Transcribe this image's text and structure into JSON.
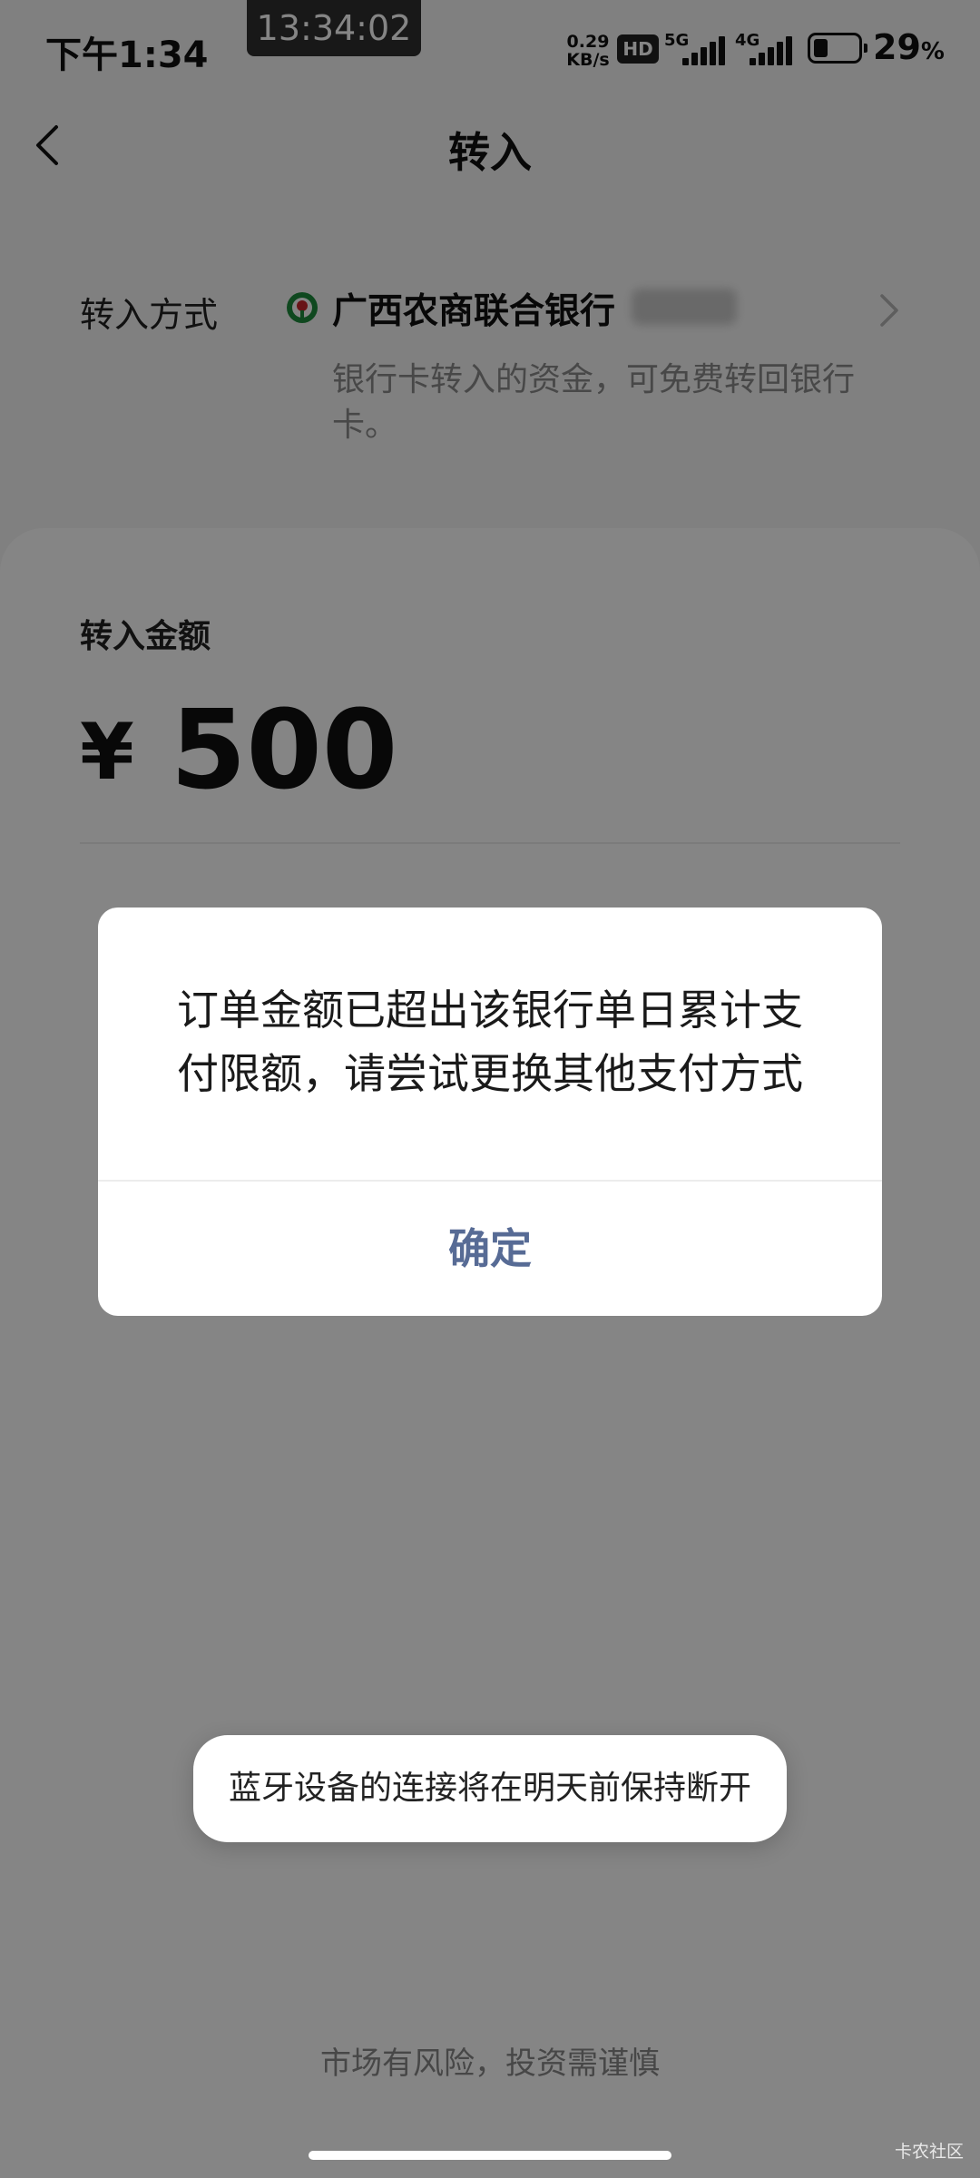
{
  "status_bar": {
    "time": "下午1:34",
    "clock_overlay": "13:34:02",
    "net_speed_value": "0.29",
    "net_speed_unit": "KB/s",
    "hd_badge": "HD",
    "signal_1_label": "5G",
    "signal_2_label": "4G",
    "battery_percent": "29",
    "battery_unit": "%"
  },
  "nav": {
    "title": "转入"
  },
  "transfer_method": {
    "label": "转入方式",
    "bank_name": "广西农商联合银行",
    "description": "银行卡转入的资金，可免费转回银行卡。"
  },
  "amount": {
    "label": "转入金额",
    "currency": "¥",
    "value": "500"
  },
  "dialog": {
    "message": "订单金额已超出该银行单日累计支付限额，请尝试更换其他支付方式",
    "confirm_label": "确定"
  },
  "toast": {
    "text": "蓝牙设备的连接将在明天前保持断开"
  },
  "footer": {
    "risk_note": "市场有风险，投资需谨慎"
  },
  "watermark": "卡农社区",
  "colors": {
    "dialog_button": "#576b95",
    "overlay": "rgba(0,0,0,0.48)"
  }
}
